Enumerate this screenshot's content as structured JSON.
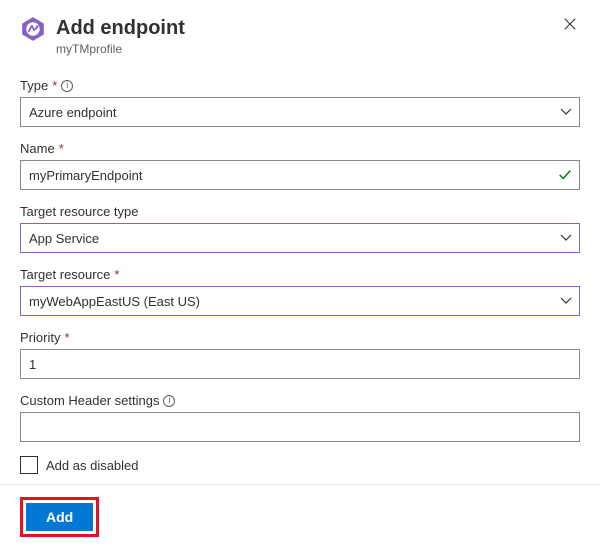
{
  "header": {
    "title": "Add endpoint",
    "subtitle": "myTMprofile"
  },
  "fields": {
    "type": {
      "label": "Type",
      "required": true,
      "info": true,
      "value": "Azure endpoint"
    },
    "name": {
      "label": "Name",
      "required": true,
      "value": "myPrimaryEndpoint",
      "valid": true
    },
    "targetResourceType": {
      "label": "Target resource type",
      "value": "App Service"
    },
    "targetResource": {
      "label": "Target resource",
      "required": true,
      "value": "myWebAppEastUS (East US)"
    },
    "priority": {
      "label": "Priority",
      "required": true,
      "value": "1"
    },
    "customHeader": {
      "label": "Custom Header settings",
      "info": true,
      "value": ""
    },
    "addAsDisabled": {
      "label": "Add as disabled",
      "checked": false
    }
  },
  "footer": {
    "addLabel": "Add"
  }
}
